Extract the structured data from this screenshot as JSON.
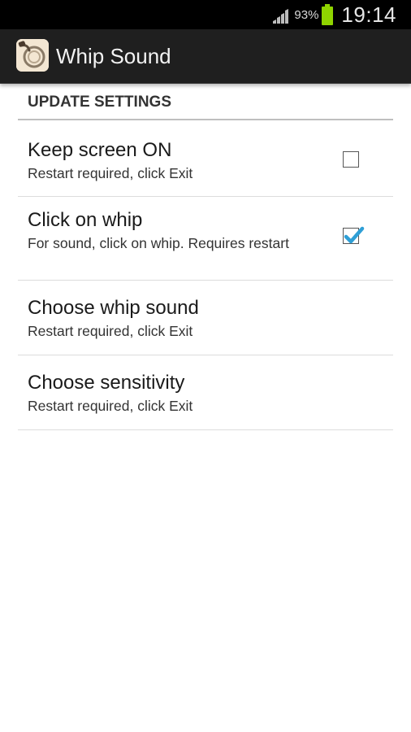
{
  "status_bar": {
    "battery_percent": "93%",
    "battery_level": 0.93,
    "time": "19:14"
  },
  "action_bar": {
    "title": "Whip Sound",
    "icon": "whip-app-icon"
  },
  "settings": {
    "category": "UPDATE SETTINGS",
    "items": [
      {
        "title": "Keep screen ON",
        "summary": "Restart required, click Exit",
        "has_checkbox": true,
        "checked": false
      },
      {
        "title": "Click on whip",
        "summary": "For sound, click on whip. Requires restart",
        "has_checkbox": true,
        "checked": true
      },
      {
        "title": "Choose whip sound",
        "summary": "Restart required, click Exit",
        "has_checkbox": false
      },
      {
        "title": "Choose sensitivity",
        "summary": "Restart required, click Exit",
        "has_checkbox": false
      }
    ]
  },
  "colors": {
    "accent_check": "#2f9fd6",
    "battery_green": "#8fd400",
    "action_bar_bg": "#1f1f1f"
  }
}
